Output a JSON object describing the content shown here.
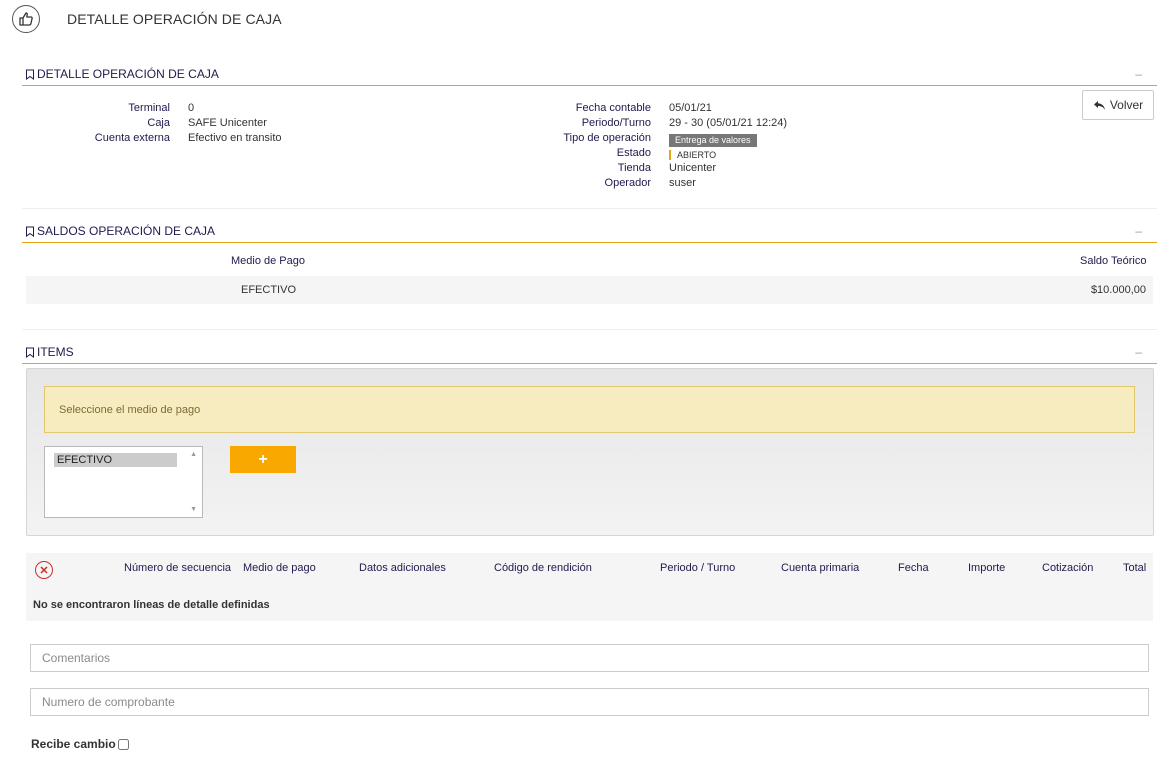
{
  "header": {
    "icon": "thumbs-up-icon",
    "title": "DETALLE OPERACIÓN DE CAJA"
  },
  "sections": {
    "detalle": {
      "title": "DETALLE OPERACIÓN DE CAJA",
      "collapse": "–"
    },
    "saldos": {
      "title": "SALDOS OPERACIÓN DE CAJA",
      "collapse": "–"
    },
    "items": {
      "title": "ITEMS",
      "collapse": "–"
    }
  },
  "detalle": {
    "left": [
      {
        "label": "Terminal",
        "value": "0"
      },
      {
        "label": "Caja",
        "value": "SAFE Unicenter"
      },
      {
        "label": "Cuenta externa",
        "value": "Efectivo en transito"
      }
    ],
    "right": {
      "fecha_contable_label": "Fecha contable",
      "fecha_contable": "05/01/21",
      "periodo_label": "Periodo/Turno",
      "periodo": "29 - 30 (05/01/21 12:24)",
      "tipo_label": "Tipo de operación",
      "tipo": "Entrega de valores",
      "estado_label": "Estado",
      "estado": "ABIERTO",
      "tienda_label": "Tienda",
      "tienda": "Unicenter",
      "operador_label": "Operador",
      "operador": "suser"
    },
    "volver_label": "Volver"
  },
  "saldos": {
    "headers": {
      "medio": "Medio de Pago",
      "saldo": "Saldo Teórico"
    },
    "rows": [
      {
        "medio": "EFECTIVO",
        "saldo": "$10.000,00"
      }
    ]
  },
  "items": {
    "alert": "Seleccione el medio de pago",
    "options": [
      "EFECTIVO"
    ],
    "add_label": "+"
  },
  "lines": {
    "headers": [
      "Número de secuencia",
      "Medio de pago",
      "Datos adicionales",
      "Código de rendición",
      "Periodo / Turno",
      "Cuenta primaria",
      "Fecha",
      "Importe",
      "Cotización",
      "Total"
    ],
    "empty": "No se encontraron líneas de detalle definidas"
  },
  "form": {
    "comentarios_placeholder": "Comentarios",
    "comprobante_placeholder": "Numero de comprobante",
    "recibe_cambio_label": "Recibe cambio"
  },
  "colors": {
    "accent": "#e8a317",
    "button": "#f9a800",
    "label": "#1e1b4d"
  }
}
